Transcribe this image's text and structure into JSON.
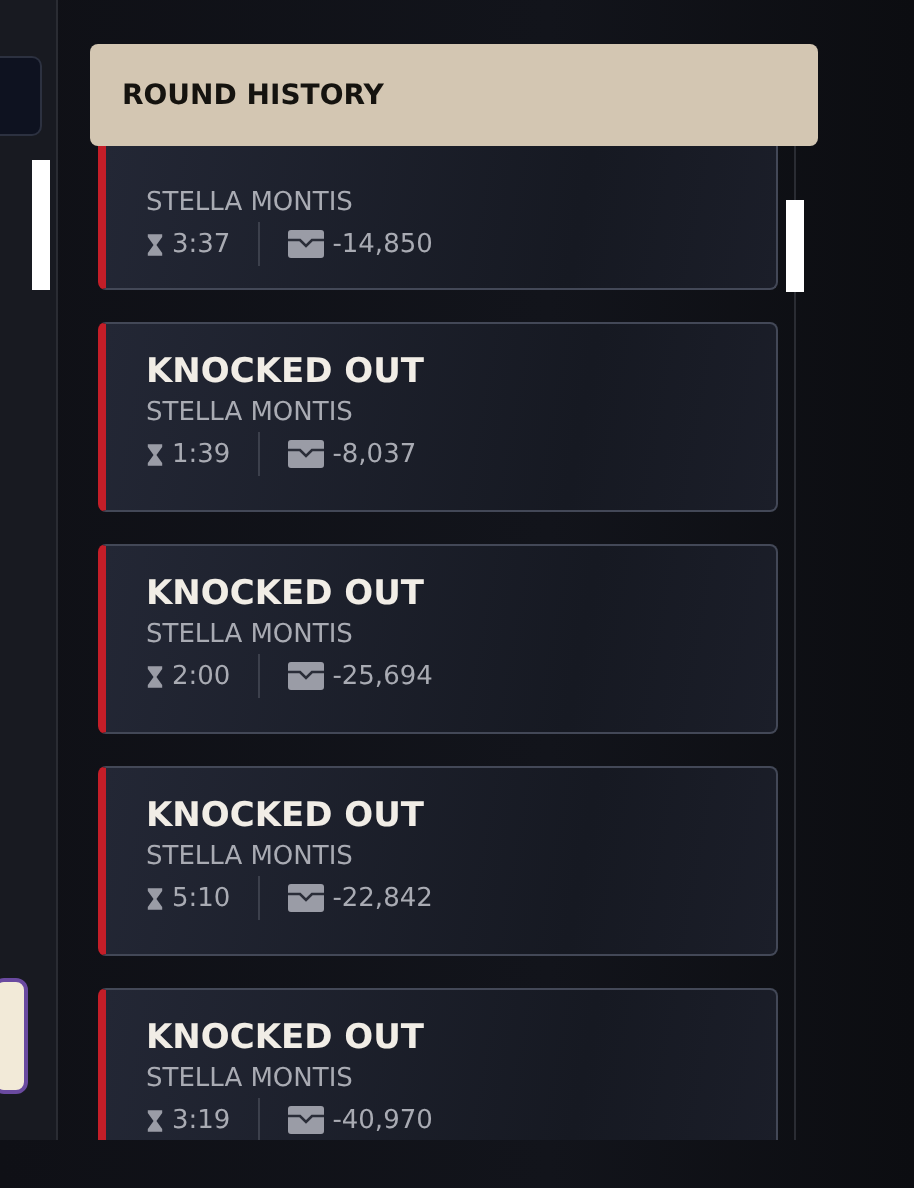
{
  "header": {
    "title": "ROUND HISTORY"
  },
  "rounds": [
    {
      "map": "STELLA MONTIS",
      "time": "3:37",
      "amount": "-14,850"
    },
    {
      "result": "KNOCKED OUT",
      "map": "STELLA MONTIS",
      "time": "1:39",
      "amount": "-8,037"
    },
    {
      "result": "KNOCKED OUT",
      "map": "STELLA MONTIS",
      "time": "2:00",
      "amount": "-25,694"
    },
    {
      "result": "KNOCKED OUT",
      "map": "STELLA MONTIS",
      "time": "5:10",
      "amount": "-22,842"
    },
    {
      "result": "KNOCKED OUT",
      "map": "STELLA MONTIS",
      "time": "3:19",
      "amount": "-40,970"
    }
  ]
}
